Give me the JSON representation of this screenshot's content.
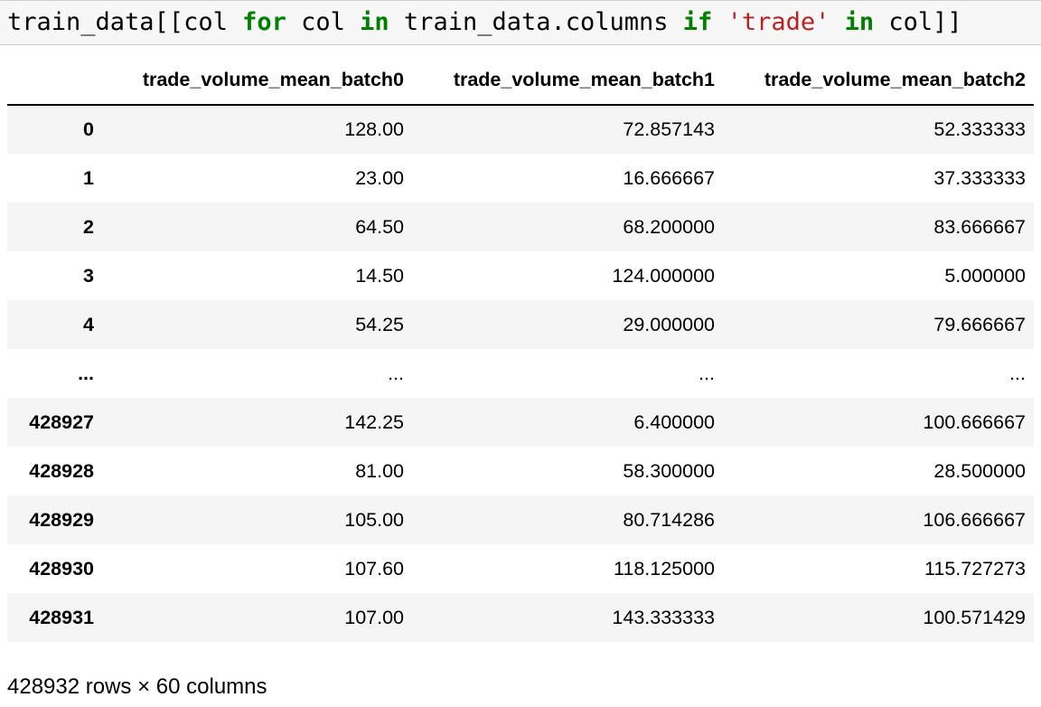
{
  "code": {
    "tokens": [
      {
        "text": "train_data[[col ",
        "cls": ""
      },
      {
        "text": "for",
        "cls": "kw"
      },
      {
        "text": " col ",
        "cls": ""
      },
      {
        "text": "in",
        "cls": "kw"
      },
      {
        "text": " train_data.columns ",
        "cls": ""
      },
      {
        "text": "if",
        "cls": "kw"
      },
      {
        "text": " ",
        "cls": ""
      },
      {
        "text": "'trade'",
        "cls": "str"
      },
      {
        "text": " ",
        "cls": ""
      },
      {
        "text": "in",
        "cls": "kw"
      },
      {
        "text": " col]]",
        "cls": ""
      }
    ]
  },
  "table": {
    "index_header": "",
    "columns": [
      "trade_volume_mean_batch0",
      "trade_volume_mean_batch1",
      "trade_volume_mean_batch2"
    ],
    "rows": [
      {
        "index": "0",
        "values": [
          "128.00",
          "72.857143",
          "52.333333"
        ]
      },
      {
        "index": "1",
        "values": [
          "23.00",
          "16.666667",
          "37.333333"
        ]
      },
      {
        "index": "2",
        "values": [
          "64.50",
          "68.200000",
          "83.666667"
        ]
      },
      {
        "index": "3",
        "values": [
          "14.50",
          "124.000000",
          "5.000000"
        ]
      },
      {
        "index": "4",
        "values": [
          "54.25",
          "29.000000",
          "79.666667"
        ]
      },
      {
        "index": "...",
        "values": [
          "...",
          "...",
          "..."
        ]
      },
      {
        "index": "428927",
        "values": [
          "142.25",
          "6.400000",
          "100.666667"
        ]
      },
      {
        "index": "428928",
        "values": [
          "81.00",
          "58.300000",
          "28.500000"
        ]
      },
      {
        "index": "428929",
        "values": [
          "105.00",
          "80.714286",
          "106.666667"
        ]
      },
      {
        "index": "428930",
        "values": [
          "107.60",
          "118.125000",
          "115.727273"
        ]
      },
      {
        "index": "428931",
        "values": [
          "107.00",
          "143.333333",
          "100.571429"
        ]
      }
    ]
  },
  "footer": {
    "shape_text": "428932 rows × 60 columns"
  },
  "colors": {
    "keyword": "#008000",
    "string": "#ba2121",
    "code_background": "#f7f7f7",
    "striped_row": "#f5f5f5"
  }
}
